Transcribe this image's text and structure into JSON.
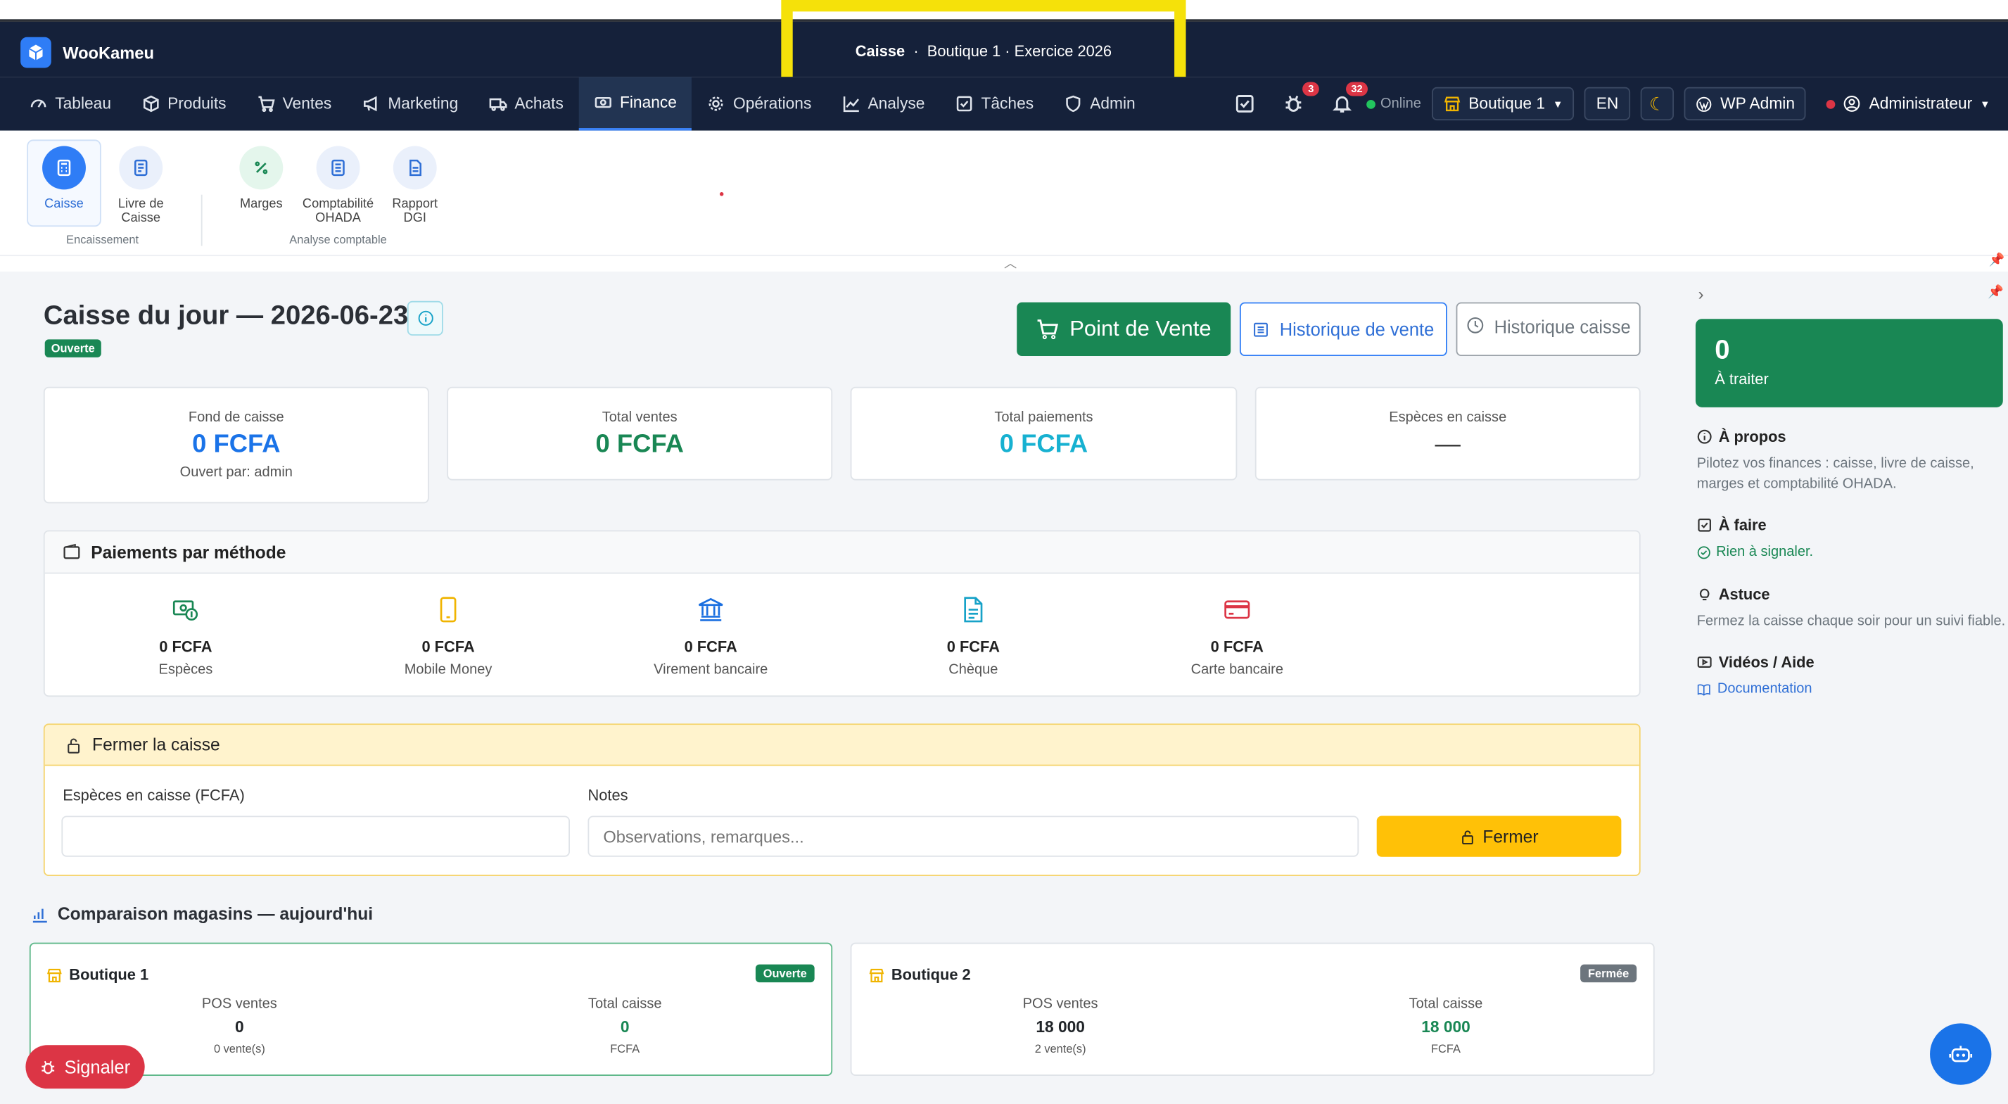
{
  "app": {
    "name": "WooKameu"
  },
  "context": {
    "module": "Caisse",
    "detail": "Boutique 1 · Exercice 2026"
  },
  "nav": {
    "items": [
      {
        "label": "Tableau",
        "icon": "gauge-icon"
      },
      {
        "label": "Produits",
        "icon": "box-icon"
      },
      {
        "label": "Ventes",
        "icon": "cart-icon"
      },
      {
        "label": "Marketing",
        "icon": "megaphone-icon"
      },
      {
        "label": "Achats",
        "icon": "truck-icon"
      },
      {
        "label": "Finance",
        "icon": "cash-icon",
        "active": true
      },
      {
        "label": "Opérations",
        "icon": "gear-icon"
      },
      {
        "label": "Analyse",
        "icon": "chart-icon"
      },
      {
        "label": "Tâches",
        "icon": "check-square-icon"
      },
      {
        "label": "Admin",
        "icon": "shield-icon"
      }
    ],
    "bug_count": "3",
    "notif_count": "32",
    "status": "Online",
    "store": "Boutique 1",
    "lang": "EN",
    "wp_admin": "WP Admin",
    "user": "Administrateur"
  },
  "subnav": {
    "tiles": [
      {
        "label": "Caisse",
        "icon": "calculator-icon"
      },
      {
        "label": "Livre de Caisse",
        "icon": "ledger-icon"
      },
      {
        "label": "Marges",
        "icon": "percent-icon"
      },
      {
        "label": "Comptabilité OHADA",
        "icon": "journal-icon"
      },
      {
        "label": "Rapport DGI",
        "icon": "report-icon"
      }
    ],
    "groups": {
      "encaissement": "Encaissement",
      "analyse": "Analyse comptable"
    }
  },
  "page": {
    "title": "Caisse du jour — 2026-06-23",
    "status": "Ouverte",
    "buttons": {
      "pos": "Point de Vente",
      "sales_history": "Historique de vente",
      "cash_history": "Historique caisse"
    }
  },
  "stats": [
    {
      "label": "Fond de caisse",
      "value": "0 FCFA",
      "sub": "Ouvert par: admin",
      "color": "#1a73e8"
    },
    {
      "label": "Total ventes",
      "value": "0 FCFA",
      "color": "#198754"
    },
    {
      "label": "Total paiements",
      "value": "0 FCFA",
      "color": "#17b1d1"
    },
    {
      "label": "Espèces en caisse",
      "value": "—",
      "color": "#333333"
    }
  ],
  "payments": {
    "title": "Paiements par méthode",
    "methods": [
      {
        "amount": "0 FCFA",
        "name": "Espèces",
        "color": "#198754",
        "icon": "cash-money-icon"
      },
      {
        "amount": "0 FCFA",
        "name": "Mobile Money",
        "color": "#f0b400",
        "icon": "phone-icon"
      },
      {
        "amount": "0 FCFA",
        "name": "Virement bancaire",
        "color": "#1a6fe0",
        "icon": "bank-icon"
      },
      {
        "amount": "0 FCFA",
        "name": "Chèque",
        "color": "#17a2c8",
        "icon": "document-icon"
      },
      {
        "amount": "0 FCFA",
        "name": "Carte bancaire",
        "color": "#dc3545",
        "icon": "credit-card-icon"
      }
    ]
  },
  "close": {
    "title": "Fermer la caisse",
    "cash_label": "Espèces en caisse (FCFA)",
    "cash_value": "",
    "notes_label": "Notes",
    "notes_placeholder": "Observations, remarques...",
    "button": "Fermer"
  },
  "compare": {
    "title": "Comparaison magasins — aujourd'hui",
    "stores": [
      {
        "name": "Boutique 1",
        "status": "Ouverte",
        "pos_label": "POS ventes",
        "pos_value": "0",
        "pos_sub": "0 vente(s)",
        "total_label": "Total caisse",
        "total_value": "0",
        "total_sub": "FCFA"
      },
      {
        "name": "Boutique 2",
        "status": "Fermée",
        "pos_label": "POS ventes",
        "pos_value": "18 000",
        "pos_sub": "2 vente(s)",
        "total_label": "Total caisse",
        "total_value": "18 000",
        "total_sub": "FCFA"
      }
    ]
  },
  "sidebar": {
    "todo_count": "0",
    "todo_label": "À traiter",
    "about_title": "À propos",
    "about_text": "Pilotez vos finances : caisse, livre de caisse, marges et comptabilité OHADA.",
    "todo_title": "À faire",
    "todo_text": "Rien à signaler.",
    "tip_title": "Astuce",
    "tip_text": "Fermez la caisse chaque soir pour un suivi fiable.",
    "video_title": "Vidéos / Aide",
    "doc_link": "Documentation"
  },
  "report_button": "Signaler"
}
